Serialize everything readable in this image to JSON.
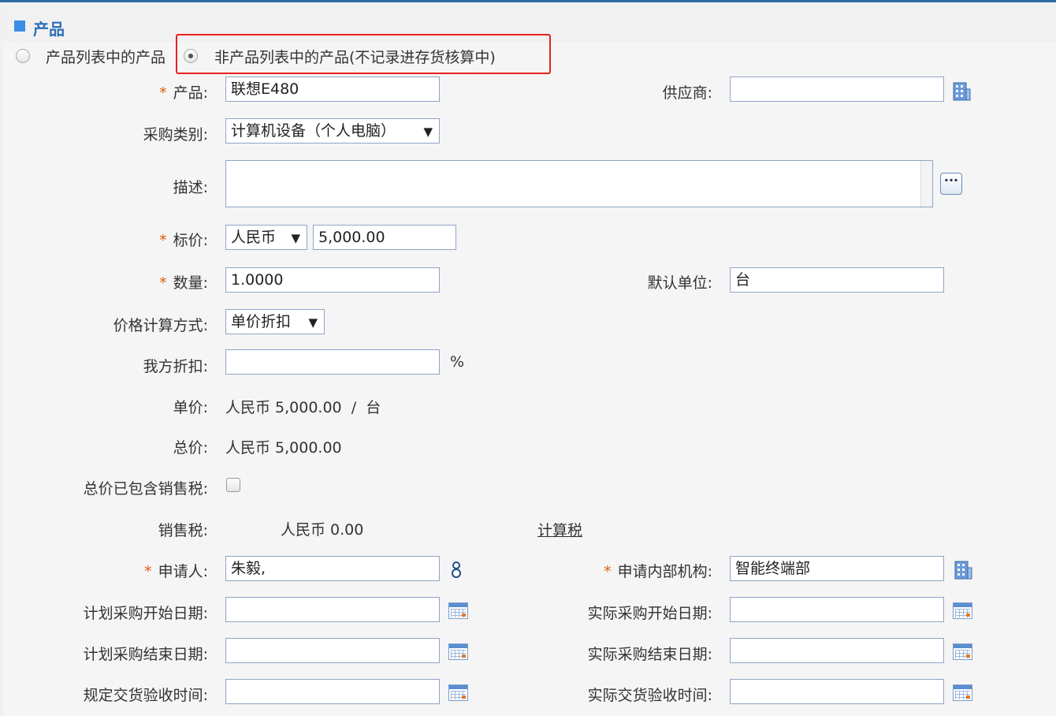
{
  "section": {
    "title": "产品"
  },
  "product_mode": {
    "option_list_label": "产品列表中的产品",
    "option_nonlist_label": "非产品列表中的产品(不记录进存货核算中)",
    "selected": "non-list"
  },
  "fields": {
    "product": {
      "label": "产品:",
      "value": "联想E480",
      "required": true
    },
    "supplier": {
      "label": "供应商:",
      "value": ""
    },
    "purchase_type": {
      "label": "采购类别:",
      "value": "计算机设备（个人电脑）"
    },
    "description": {
      "label": "描述:",
      "value": ""
    },
    "list_price": {
      "label": "标价:",
      "currency": "人民币",
      "value": "5,000.00",
      "required": true
    },
    "quantity": {
      "label": "数量:",
      "value": "1.0000",
      "required": true
    },
    "default_unit": {
      "label": "默认单位:",
      "value": "台"
    },
    "price_calc": {
      "label": "价格计算方式:",
      "value": "单价折扣"
    },
    "our_discount": {
      "label": "我方折扣:",
      "value": "",
      "suffix": "%"
    },
    "unit_price": {
      "label": "单价:",
      "value": "人民币 5,000.00",
      "sep": "/",
      "unit": "台"
    },
    "total_price": {
      "label": "总价:",
      "value": "人民币 5,000.00"
    },
    "tax_included": {
      "label": "总价已包含销售税:",
      "checked": false
    },
    "sales_tax": {
      "label": "销售税:",
      "value": "人民币 0.00",
      "calc_link": "计算税"
    },
    "applicant": {
      "label": "申请人:",
      "value": "朱毅,",
      "required": true
    },
    "department": {
      "label": "申请内部机构:",
      "value": "智能终端部",
      "required": true
    },
    "plan_start": {
      "label": "计划采购开始日期:",
      "value": ""
    },
    "actual_start": {
      "label": "实际采购开始日期:",
      "value": ""
    },
    "plan_end": {
      "label": "计划采购结束日期:",
      "value": ""
    },
    "actual_end": {
      "label": "实际采购结束日期:",
      "value": ""
    },
    "delivery_due": {
      "label": "规定交货验收时间:",
      "value": ""
    },
    "delivery_actual": {
      "label": "实际交货验收时间:",
      "value": ""
    }
  },
  "icons": {
    "select_arrow": "▼",
    "more": "···",
    "required_mark": "*",
    "building": "building-icon",
    "calendar": "calendar-icon",
    "user": "user-icon"
  },
  "colors": {
    "accent": "#2a6fb8",
    "required": "#e25a0e",
    "highlight_box": "#e8211f"
  }
}
